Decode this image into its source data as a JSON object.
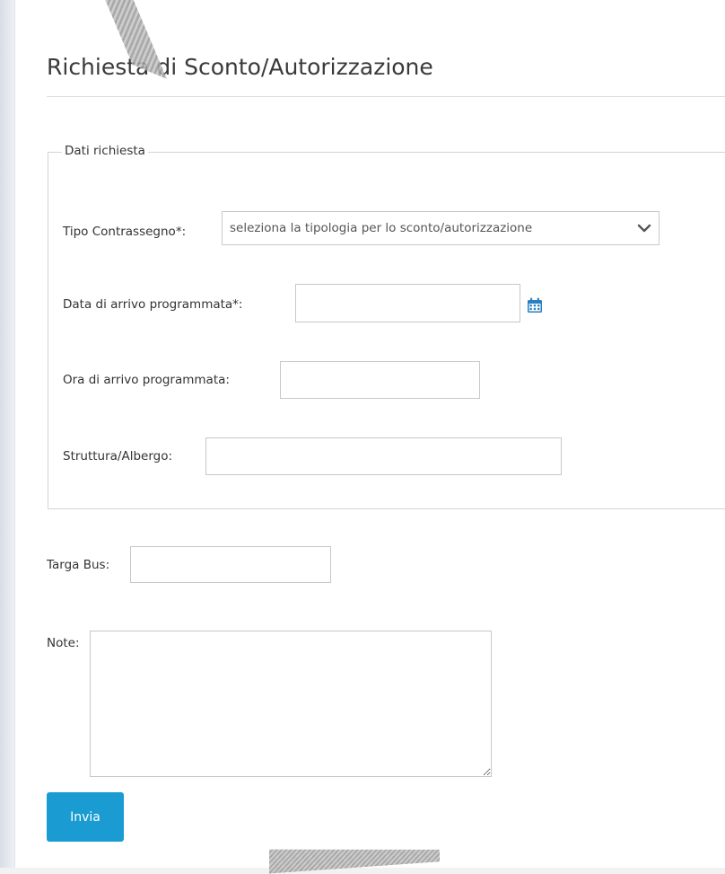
{
  "page": {
    "title": "Richiesta di Sconto/Autorizzazione"
  },
  "fieldset": {
    "legend": "Dati richiesta"
  },
  "fields": {
    "tipo": {
      "label": "Tipo Contrassegno*:",
      "selected": "seleziona la tipologia per lo sconto/autorizzazione"
    },
    "data_arrivo": {
      "label": "Data di arrivo programmata*:",
      "value": ""
    },
    "ora_arrivo": {
      "label": "Ora di arrivo programmata:",
      "value": ""
    },
    "struttura": {
      "label": "Struttura/Albergo:",
      "value": ""
    },
    "targa": {
      "label": "Targa Bus:",
      "value": ""
    },
    "note": {
      "label": "Note:",
      "value": ""
    }
  },
  "actions": {
    "submit_label": "Invia"
  },
  "icons": {
    "calendar": "calendar-icon",
    "chevron": "chevron-down-icon"
  },
  "colors": {
    "primary": "#1a9bd1",
    "calendar_icon": "#2a7fc1",
    "border": "#c8c8c8"
  }
}
